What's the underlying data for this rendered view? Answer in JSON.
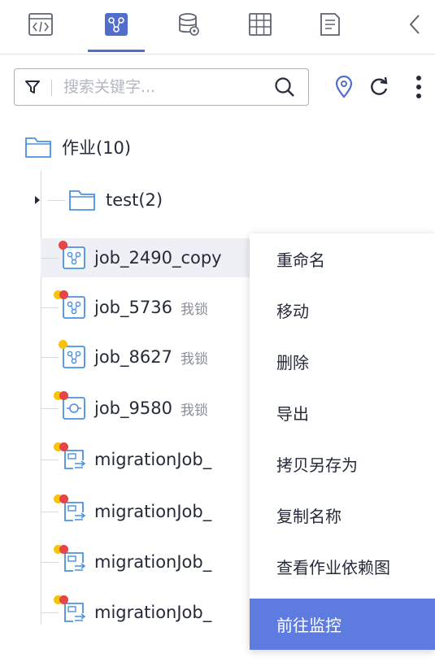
{
  "tabs": [
    {
      "icon": "code-file-icon"
    },
    {
      "icon": "job-flow-icon",
      "active": true
    },
    {
      "icon": "database-settings-icon"
    },
    {
      "icon": "table-grid-icon"
    },
    {
      "icon": "document-icon"
    }
  ],
  "search": {
    "placeholder": "搜索关键字..."
  },
  "tree": {
    "root": {
      "label": "作业",
      "count": "(10)"
    },
    "folder": {
      "label": "test",
      "count": "(2)"
    },
    "items": [
      {
        "label": "job_2490_copy",
        "meta": "",
        "icon": "job-flow-icon",
        "dots": [
          "#e54545"
        ]
      },
      {
        "label": "job_5736",
        "meta": "我锁",
        "icon": "job-flow-icon",
        "dots": [
          "#fac20a",
          "#e54545"
        ]
      },
      {
        "label": "job_8627",
        "meta": "我锁",
        "icon": "job-flow-icon",
        "dots": [
          "#fac20a"
        ]
      },
      {
        "label": "job_9580",
        "meta": "我锁",
        "icon": "job-single-icon",
        "dots": [
          "#fac20a",
          "#e54545"
        ]
      },
      {
        "label": "migrationJob_",
        "meta": "",
        "icon": "migration-job-icon",
        "dots": [
          "#fac20a",
          "#e54545"
        ]
      },
      {
        "label": "migrationJob_",
        "meta": "",
        "icon": "migration-job-icon",
        "dots": [
          "#fac20a",
          "#e54545"
        ]
      },
      {
        "label": "migrationJob_",
        "meta": "",
        "icon": "migration-job-icon",
        "dots": [
          "#fac20a",
          "#e54545"
        ]
      },
      {
        "label": "migrationJob_",
        "meta": "",
        "icon": "migration-job-icon",
        "dots": [
          "#fac20a",
          "#e54545"
        ]
      }
    ]
  },
  "context_menu": {
    "items": [
      "重命名",
      "移动",
      "删除",
      "导出",
      "拷贝另存为",
      "复制名称",
      "查看作业依赖图",
      "前往监控"
    ],
    "active_index": 7
  },
  "colors": {
    "accent": "#526ecc",
    "menu_active": "#5e7ce0",
    "icon_blue": "#4a90e2",
    "dot_red": "#e54545",
    "dot_yellow": "#fac20a"
  }
}
